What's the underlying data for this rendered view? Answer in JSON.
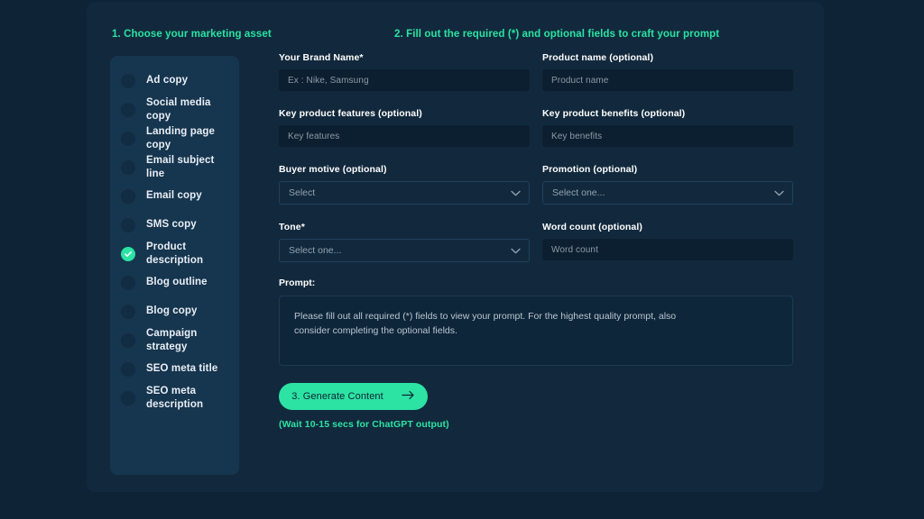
{
  "colors": {
    "page_bg": "#0e2336",
    "card_bg": "#12293d",
    "panel_bg": "#16354e",
    "input_bg": "#0c1f30",
    "accent_green": "#2ce3a4",
    "label_text": "#ffffff",
    "placeholder_text": "#8c9aa8"
  },
  "sidebar": {
    "heading": "1. Choose your marketing asset",
    "items": [
      {
        "label": "Ad copy",
        "selected": false,
        "icon": "circle-bullet-icon"
      },
      {
        "label": "Social media copy",
        "selected": false,
        "icon": "circle-bullet-icon"
      },
      {
        "label": "Landing page copy",
        "selected": false,
        "icon": "circle-bullet-icon"
      },
      {
        "label": "Email subject line",
        "selected": false,
        "icon": "circle-bullet-icon"
      },
      {
        "label": "Email copy",
        "selected": false,
        "icon": "circle-bullet-icon"
      },
      {
        "label": "SMS copy",
        "selected": false,
        "icon": "circle-bullet-icon"
      },
      {
        "label": "Product description",
        "selected": true,
        "icon": "check-circle-icon"
      },
      {
        "label": "Blog outline",
        "selected": false,
        "icon": "circle-bullet-icon"
      },
      {
        "label": "Blog copy",
        "selected": false,
        "icon": "circle-bullet-icon"
      },
      {
        "label": "Campaign strategy",
        "selected": false,
        "icon": "circle-bullet-icon"
      },
      {
        "label": "SEO meta title",
        "selected": false,
        "icon": "circle-bullet-icon"
      },
      {
        "label": "SEO meta description",
        "selected": false,
        "icon": "circle-bullet-icon"
      }
    ]
  },
  "form": {
    "heading": "2. Fill out the required (*) and optional fields to craft your prompt",
    "fields": [
      {
        "label": "Your Brand Name*",
        "type": "text",
        "value": "",
        "placeholder": "Ex : Nike, Samsung"
      },
      {
        "label": "Product name (optional)",
        "type": "text",
        "value": "",
        "placeholder": "Product name"
      },
      {
        "label": "Key product features (optional)",
        "type": "text",
        "value": "",
        "placeholder": "Key features"
      },
      {
        "label": "Key product benefits (optional)",
        "type": "text",
        "value": "",
        "placeholder": "Key benefits"
      },
      {
        "label": "Buyer motive (optional)",
        "type": "select",
        "value": "",
        "placeholder": "Select"
      },
      {
        "label": "Promotion (optional)",
        "type": "select",
        "value": "",
        "placeholder": "Select one..."
      },
      {
        "label": "Tone*",
        "type": "select",
        "value": "",
        "placeholder": "Select one..."
      },
      {
        "label": "Word count (optional)",
        "type": "text",
        "value": "",
        "placeholder": "Word count"
      }
    ],
    "prompt": {
      "label": "Prompt:",
      "text": "Please fill out all required (*) fields to view your prompt. For the highest quality prompt, also consider completing the optional fields."
    },
    "generate": {
      "label": "3. Generate Content",
      "icon": "arrow-right-icon",
      "note": "(Wait 10-15 secs for ChatGPT output)"
    }
  }
}
